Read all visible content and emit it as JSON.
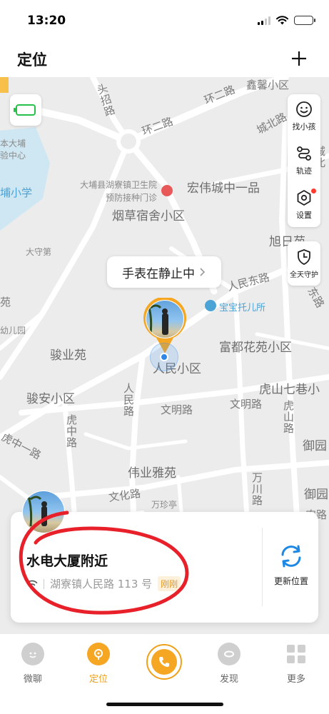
{
  "status_bar": {
    "time": "13:20"
  },
  "header": {
    "title": "定位"
  },
  "map": {
    "labels": [
      "鑫馨小区",
      "环二路",
      "城北路",
      "头招路",
      "环二路",
      "大埔县湖寮镇卫生院 预防接种门诊",
      "宏伟城中一品",
      "烟草宿舍小区",
      "旭日苑",
      "大守第",
      "人民东路",
      "宝宝托儿所",
      "富都花苑小区",
      "骏业苑",
      "人民小区",
      "骏安小区",
      "人民路",
      "文明路",
      "文明路",
      "虎山七巷小",
      "虎山路",
      "虎中路",
      "虎中一路",
      "伟业雅苑",
      "文化路",
      "万珍亭",
      "万川路",
      "御园",
      "御园",
      "苑",
      "幼儿园",
      "本大埔",
      "验中心",
      "埔小学",
      "城北",
      "东路",
      "农路"
    ],
    "status_bubble": "手表在静止中",
    "side_buttons": [
      {
        "label": "找小孩",
        "icon": "smile-icon"
      },
      {
        "label": "轨迹",
        "icon": "track-icon"
      },
      {
        "label": "设置",
        "icon": "settings-icon"
      }
    ],
    "guard_button": {
      "label": "全天守护",
      "icon": "shield-clock-icon"
    }
  },
  "location_card": {
    "place": "水电大厦附近",
    "address": "湖寮镇人民路 113 号",
    "badge": "刚刚",
    "refresh_label": "更新位置"
  },
  "tabbar": {
    "tabs": [
      {
        "label": "微聊",
        "icon": "chat-icon",
        "active": false
      },
      {
        "label": "定位",
        "icon": "location-icon",
        "active": true
      },
      {
        "label": "",
        "icon": "phone-icon",
        "active": false
      },
      {
        "label": "发现",
        "icon": "discover-icon",
        "active": false
      },
      {
        "label": "更多",
        "icon": "grid-icon",
        "active": false
      }
    ]
  },
  "colors": {
    "accent": "#f0a11a",
    "map_bg": "#ececec",
    "annotation": "#e8202a",
    "battery_green": "#27c04a"
  }
}
